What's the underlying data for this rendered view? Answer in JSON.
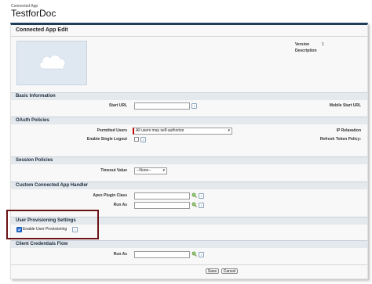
{
  "header": {
    "subtitle": "Connected App",
    "title": "TestforDoc"
  },
  "panel": {
    "title": "Connected App Edit"
  },
  "version": {
    "version_label": "Version",
    "version_value": "1",
    "description_label": "Description"
  },
  "sections": {
    "basic": "Basic Information",
    "oauth": "OAuth Policies",
    "session": "Session Policies",
    "handler": "Custom Connected App Handler",
    "provisioning": "User Provisioning Settings",
    "client": "Client Credentials Flow"
  },
  "fields": {
    "start_url": "Start URL",
    "mobile_start_url": "Mobile Start URL",
    "permitted_users": "Permitted Users",
    "permitted_users_value": "All users may self-authorize",
    "ip_relaxation": "IP Relaxation",
    "enable_single_logout": "Enable Single Logout",
    "refresh_token_policy": "Refresh Token Policy:",
    "timeout_value": "Timeout Value",
    "timeout_selected": "--None--",
    "apex_plugin_class": "Apex Plugin Class",
    "run_as": "Run As",
    "enable_user_provisioning": "Enable User Provisioning",
    "client_run_as": "Run As"
  },
  "buttons": {
    "save": "Save",
    "cancel": "Cancel"
  },
  "icons": {
    "info": "i"
  },
  "colors": {
    "header_bar": "#1f3d5a",
    "required": "#c00000",
    "highlight": "#6b1318",
    "checkbox": "#2b6fd6"
  }
}
